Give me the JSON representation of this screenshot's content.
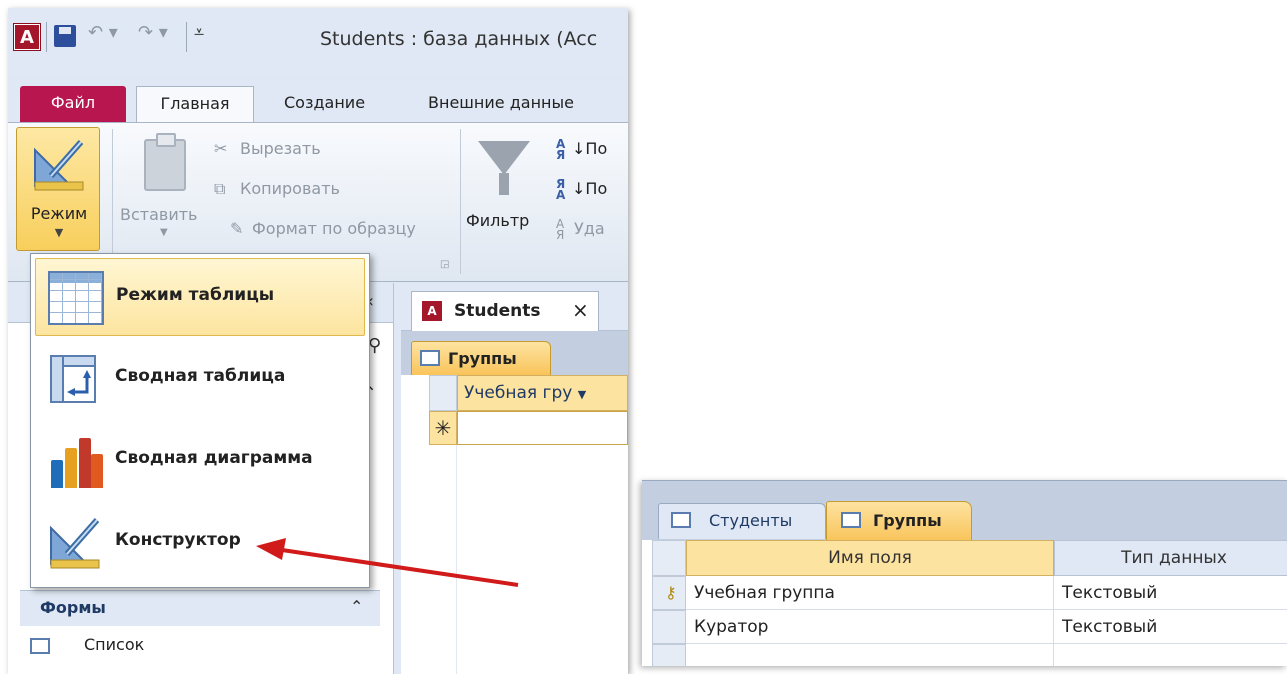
{
  "window": {
    "app_icon": "A",
    "title": "Students : база данных (Acc",
    "quick_access": [
      "save-icon",
      "undo-icon",
      "redo-icon",
      "customize-icon"
    ]
  },
  "ribbon_tabs": {
    "file": "Файл",
    "home": "Главная",
    "create": "Создание",
    "external": "Внешние данные"
  },
  "ribbon": {
    "mode_label": "Режим",
    "paste_label": "Вставить",
    "cut_label": "Вырезать",
    "copy_label": "Копировать",
    "format_painter_label": "Формат по образцу",
    "filter_label": "Фильтр",
    "sort_asc_label": "По",
    "sort_desc_label": "По",
    "remove_sort_label": "Уда"
  },
  "mode_menu": {
    "items": [
      {
        "label": "Режим таблицы",
        "icon": "datasheet-icon",
        "highlighted": true
      },
      {
        "label": "Сводная таблица",
        "icon": "pivot-table-icon",
        "highlighted": false
      },
      {
        "label": "Сводная диаграмма",
        "icon": "pivot-chart-icon",
        "highlighted": false
      },
      {
        "label": "Конструктор",
        "icon": "design-view-icon",
        "highlighted": false
      }
    ]
  },
  "nav_pane": {
    "collapse": "«",
    "forms_header": "Формы",
    "forms_chevron": "⌃",
    "forms_items": [
      "Список"
    ]
  },
  "document": {
    "tab_label": "Students",
    "close": "×",
    "object_tab": "Группы",
    "column_header": "Учебная гру",
    "new_row_marker": "✳"
  },
  "design_view": {
    "tabs": [
      "Студенты",
      "Группы"
    ],
    "headers": {
      "field_name": "Имя поля",
      "data_type": "Тип данных"
    },
    "rows": [
      {
        "field": "Учебная группа",
        "type": "Текстовый",
        "primary_key": true
      },
      {
        "field": "Куратор",
        "type": "Текстовый",
        "primary_key": false
      }
    ]
  },
  "colors": {
    "file_tab": "#b8164e",
    "highlight": "#fde3a0",
    "arrow": "#d11a1a"
  }
}
